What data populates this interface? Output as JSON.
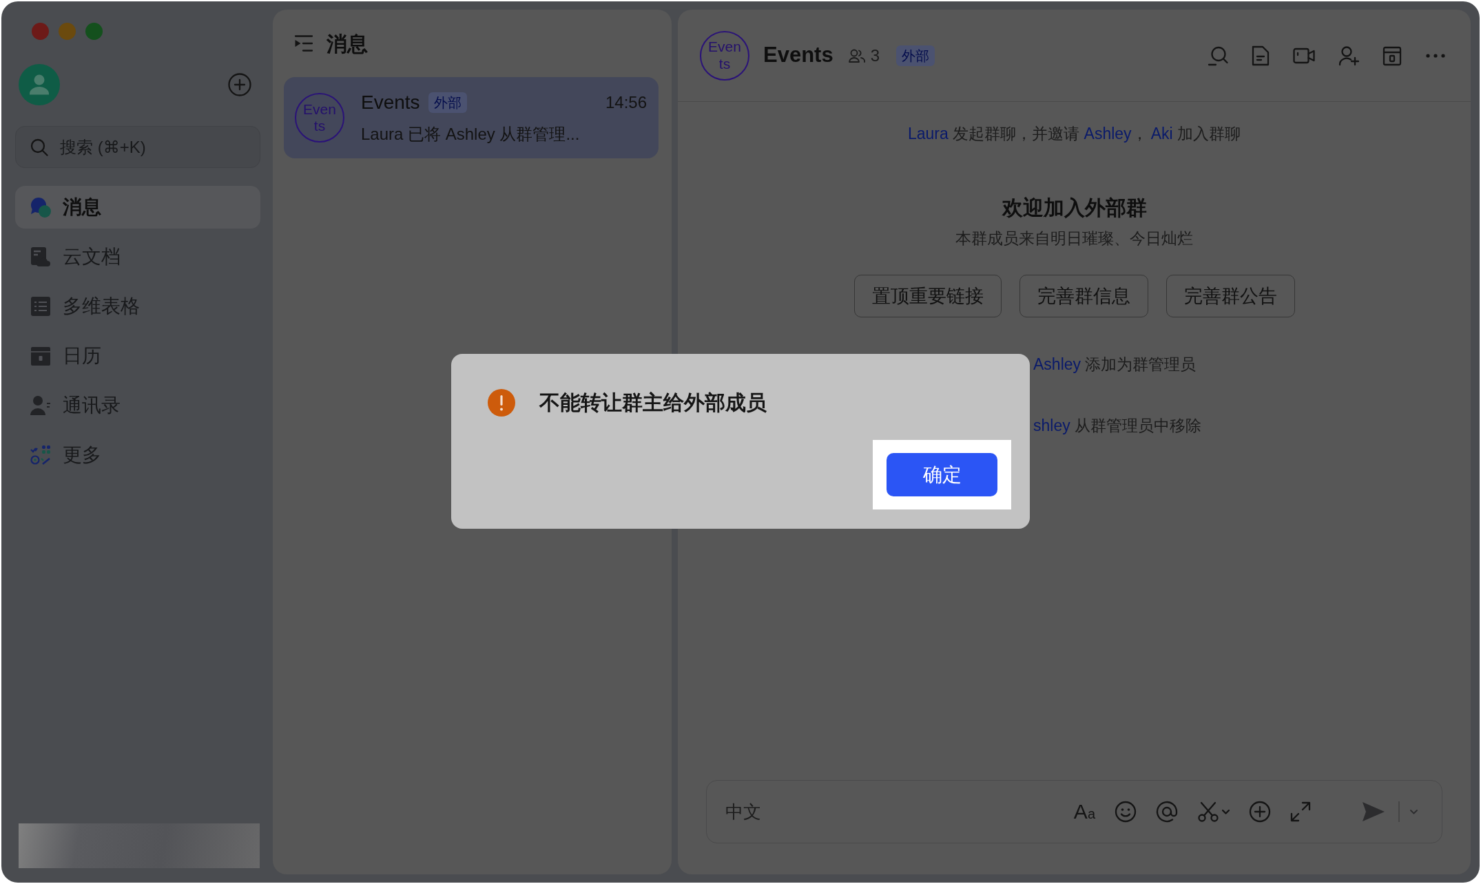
{
  "sidebar": {
    "search": {
      "placeholder": "搜索 (⌘+K)"
    },
    "items": [
      {
        "kind": "messages",
        "label": "消息",
        "selected": true
      },
      {
        "kind": "docs",
        "label": "云文档",
        "selected": false
      },
      {
        "kind": "base",
        "label": "多维表格",
        "selected": false
      },
      {
        "kind": "calendar",
        "label": "日历",
        "selected": false
      },
      {
        "kind": "contacts",
        "label": "通讯录",
        "selected": false
      },
      {
        "kind": "more",
        "label": "更多",
        "selected": false
      }
    ]
  },
  "chat_list": {
    "title": "消息",
    "chats": [
      {
        "avatar_text": "Events",
        "name": "Events",
        "tag": "外部",
        "time": "14:56",
        "preview": "Laura 已将 Ashley 从群管理...",
        "selected": true
      }
    ]
  },
  "chat": {
    "avatar_text": "Events",
    "title": "Events",
    "member_count": "3",
    "tag": "外部",
    "timeline": [
      {
        "kind": "system",
        "parts": [
          {
            "kind": "name",
            "text": "Laura"
          },
          {
            "kind": "text",
            "text": " 发起群聊，并邀请 "
          },
          {
            "kind": "name",
            "text": "Ashley"
          },
          {
            "kind": "text",
            "text": "， "
          },
          {
            "kind": "name",
            "text": "Aki"
          },
          {
            "kind": "text",
            "text": " 加入群聊"
          }
        ]
      },
      {
        "kind": "welcome",
        "title": "欢迎加入外部群",
        "subtitle": "本群成员来自明日璀璨、今日灿烂",
        "actions": [
          "置顶重要链接",
          "完善群信息",
          "完善群公告"
        ]
      },
      {
        "kind": "clipped",
        "parts": [
          {
            "kind": "name",
            "text": "Ashley"
          },
          {
            "kind": "text",
            "text": " 添加为群管理员"
          }
        ]
      },
      {
        "kind": "clipped",
        "parts": [
          {
            "kind": "name",
            "text": "shley"
          },
          {
            "kind": "text",
            "text": " 从群管理员中移除"
          }
        ]
      }
    ],
    "composer": {
      "placeholder": "中文",
      "format_glyph": "Aa"
    }
  },
  "dialog": {
    "message": "不能转让群主给外部成员",
    "buttons": [
      {
        "label": "确定",
        "highlighted": true
      }
    ]
  }
}
